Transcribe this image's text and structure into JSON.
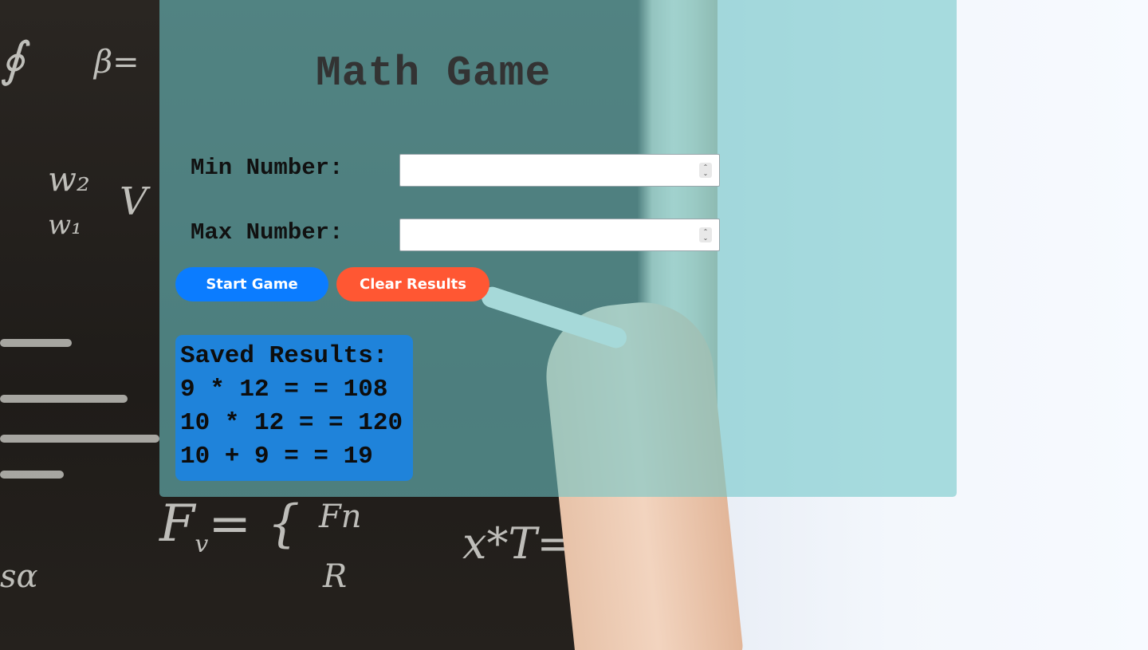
{
  "app": {
    "title": "Math Game"
  },
  "form": {
    "min_label": "Min Number:",
    "min_value": "",
    "max_label": "Max Number:",
    "max_value": ""
  },
  "buttons": {
    "start_label": "Start Game",
    "clear_label": "Clear Results"
  },
  "results": {
    "heading": "Saved Results:",
    "items": [
      "9 * 12 = = 108",
      "10 * 12 = = 120",
      "10 + 9 = = 19"
    ]
  },
  "colors": {
    "panel": "#6ec6c8",
    "start_button": "#0b7cff",
    "clear_button": "#ff5733",
    "results_box": "#1f83da",
    "title_text": "#333333"
  },
  "icons": {
    "spinner": "number-spinner-icon"
  }
}
